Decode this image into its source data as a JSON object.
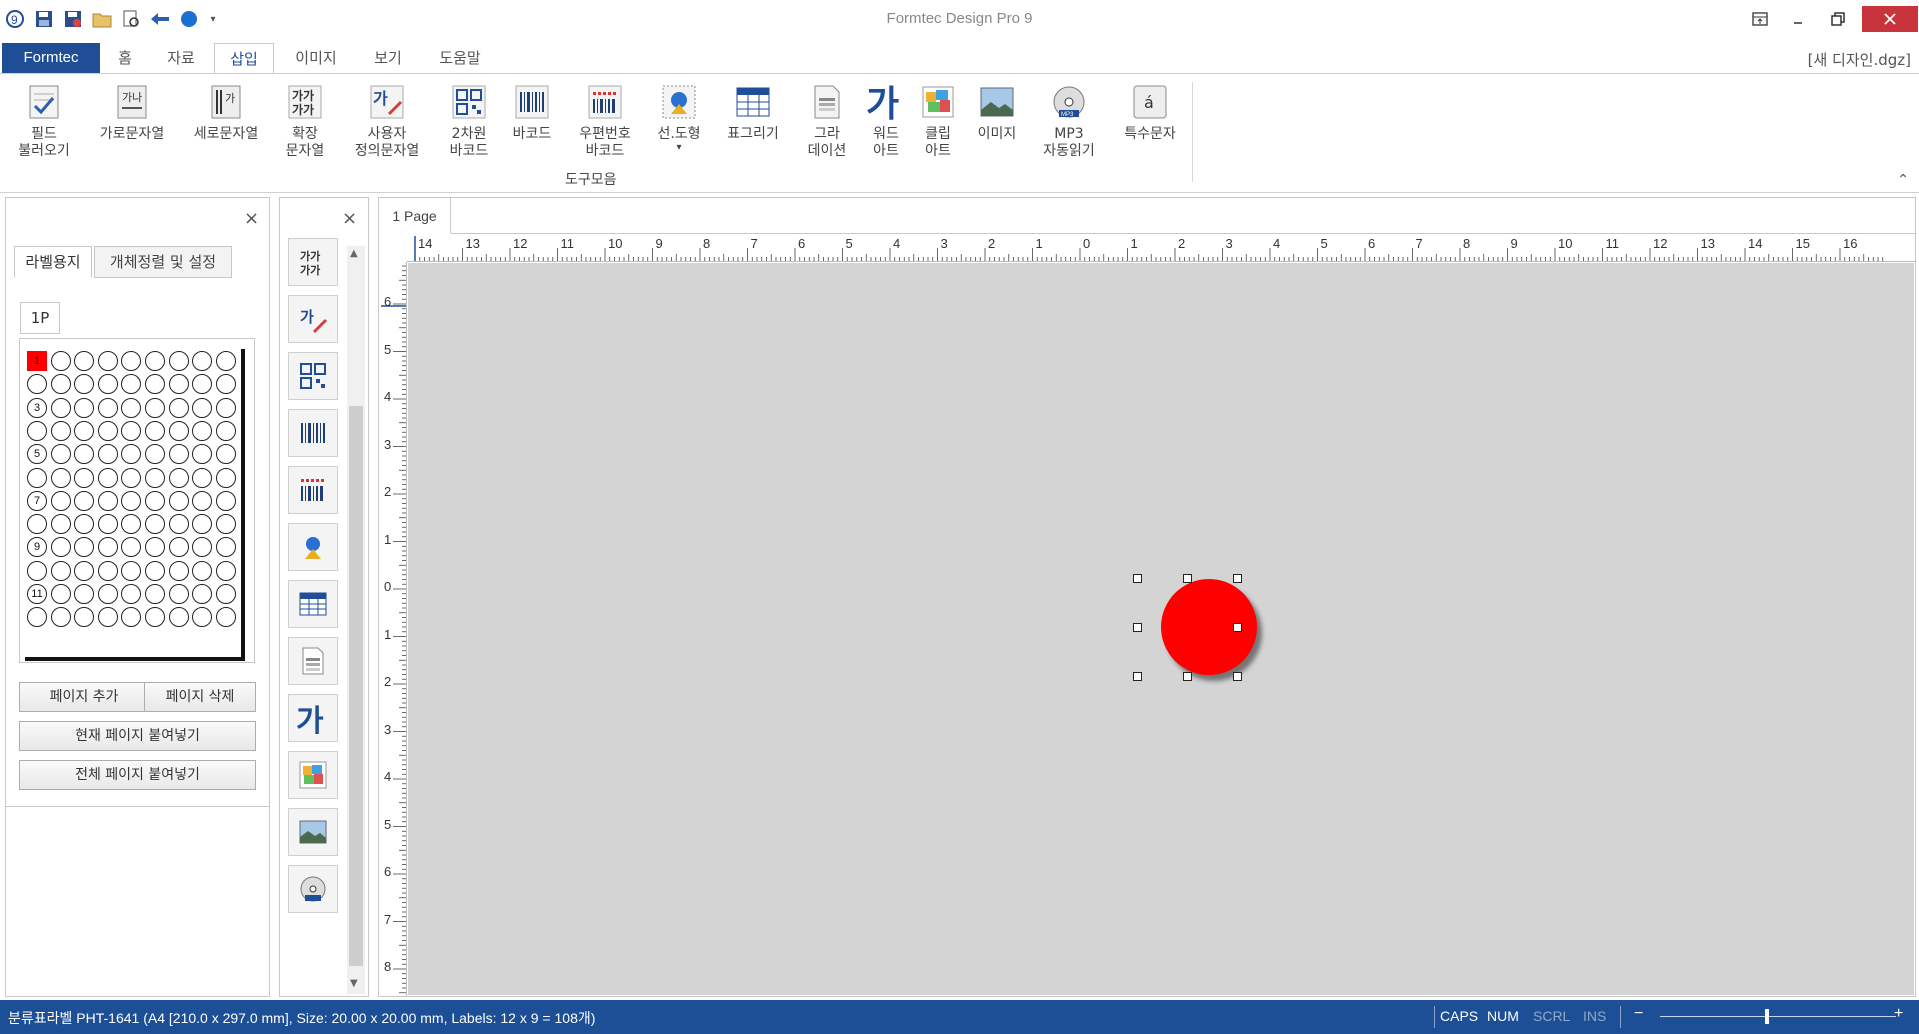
{
  "window": {
    "title": "Formtec Design Pro 9",
    "doc_name": "[새 디자인.dgz]",
    "controls": [
      "restore-ribbon",
      "minimize",
      "maximize",
      "close"
    ]
  },
  "quick_access": [
    "app-logo-icon",
    "save-icon",
    "save-as-icon",
    "open-folder-icon",
    "print-preview-icon",
    "undo-icon",
    "color-icon",
    "dropdown-icon"
  ],
  "ribbon_tabs": [
    {
      "label": "Formtec"
    },
    {
      "label": "홈"
    },
    {
      "label": "자료"
    },
    {
      "label": "삽입"
    },
    {
      "label": "이미지"
    },
    {
      "label": "보기"
    },
    {
      "label": "도움말"
    }
  ],
  "ribbon": {
    "buttons": [
      {
        "line1": "필드",
        "line2": "불러오기",
        "icon": "field-load-icon"
      },
      {
        "line1": "가로문자열",
        "line2": "",
        "icon": "horizontal-text-icon"
      },
      {
        "line1": "세로문자열",
        "line2": "",
        "icon": "vertical-text-icon"
      },
      {
        "line1": "확장",
        "line2": "문자열",
        "icon": "extended-text-icon"
      },
      {
        "line1": "사용자",
        "line2": "정의문자열",
        "icon": "custom-text-icon"
      },
      {
        "line1": "2차원",
        "line2": "바코드",
        "icon": "qr-code-icon"
      },
      {
        "line1": "바코드",
        "line2": "",
        "icon": "barcode-icon"
      },
      {
        "line1": "우편번호",
        "line2": "바코드",
        "icon": "postal-barcode-icon"
      },
      {
        "line1": "선.도형",
        "line2": "▾",
        "icon": "shape-icon"
      },
      {
        "line1": "표그리기",
        "line2": "",
        "icon": "table-icon"
      },
      {
        "line1": "그라",
        "line2": "데이션",
        "icon": "gradation-icon"
      },
      {
        "line1": "워드",
        "line2": "아트",
        "icon": "word-art-icon"
      },
      {
        "line1": "클립",
        "line2": "아트",
        "icon": "clip-art-icon"
      },
      {
        "line1": "이미지",
        "line2": "",
        "icon": "image-icon"
      },
      {
        "line1": "MP3",
        "line2": "자동읽기",
        "icon": "mp3-icon"
      },
      {
        "line1": "특수문자",
        "line2": "",
        "icon": "special-char-icon"
      }
    ],
    "group_label": "도구모음"
  },
  "left_panel": {
    "tabs": [
      "라벨용지",
      "개체정렬 및 설정"
    ],
    "page_tab": "1P",
    "grid": {
      "rows": 12,
      "cols": 9
    },
    "row_labels": [
      "1",
      "",
      "3",
      "",
      "5",
      "",
      "7",
      "",
      "9",
      "",
      "11",
      ""
    ],
    "buttons": {
      "add_page": "페이지 추가",
      "delete_page": "페이지 삭제",
      "paste_current": "현재 페이지 붙여넣기",
      "paste_all": "전체 페이지 붙여넣기"
    }
  },
  "toolbox": {
    "items": [
      "extended-text-icon",
      "custom-text-icon",
      "qr-code-icon",
      "barcode-icon",
      "postal-barcode-icon",
      "shape-icon",
      "table-icon",
      "gradation-icon",
      "word-art-icon",
      "clip-art-icon",
      "image-icon",
      "mp3-icon"
    ]
  },
  "canvas": {
    "page_tab": "1 Page",
    "h_ruler_labels": [
      "14",
      "13",
      "12",
      "11",
      "10",
      "9",
      "8",
      "7",
      "6",
      "5",
      "4",
      "3",
      "2",
      "1",
      "0",
      "1",
      "2",
      "3",
      "4",
      "5",
      "6",
      "7",
      "8",
      "9",
      "10",
      "11",
      "12",
      "13",
      "14",
      "15",
      "16"
    ],
    "v_ruler_labels": [
      "6",
      "5",
      "4",
      "3",
      "2",
      "1",
      "0",
      "1",
      "2",
      "3",
      "4",
      "5",
      "6",
      "7",
      "8"
    ],
    "object": {
      "shape": "circle",
      "color": "#ff0000"
    }
  },
  "status": {
    "info": "분류표라벨 PHT-1641 (A4 [210.0 x 297.0 mm], Size: 20.00 x 20.00 mm,  Labels: 12 x 9 = 108개)",
    "caps": "CAPS",
    "num": "NUM",
    "scrl": "SCRL",
    "ins": "INS",
    "zoom_minus": "−",
    "zoom_plus": "+"
  },
  "colors": {
    "accent": "#1f4e96",
    "status_bar": "#1c4f95",
    "close": "#c8343b",
    "object": "#ff0000",
    "work_bg": "#d4d4d4"
  }
}
